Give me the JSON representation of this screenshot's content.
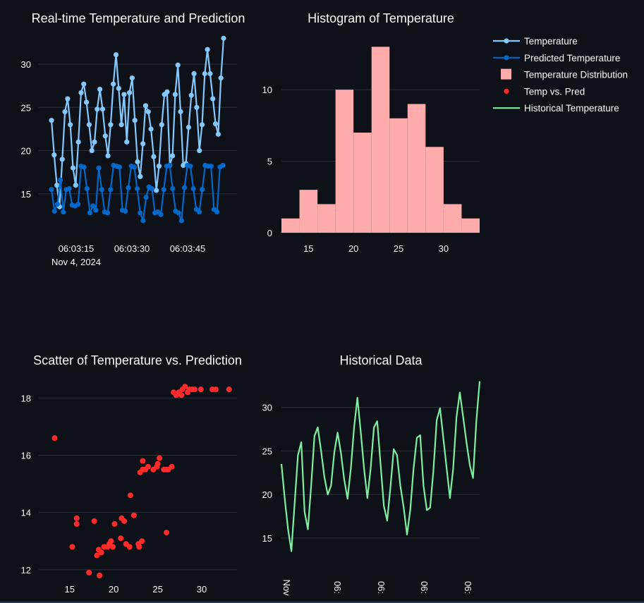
{
  "colors": {
    "background": "#0e1117",
    "grid": "#2c3140",
    "temperature": "#83c9ff",
    "predicted": "#0068c9",
    "histogram": "#ffabab",
    "scatter": "#ff2b2b",
    "historical": "#7defa1"
  },
  "legend": [
    {
      "label": "Temperature",
      "type": "line-marker",
      "color": "#83c9ff"
    },
    {
      "label": "Predicted Temperature",
      "type": "line-marker",
      "color": "#0068c9"
    },
    {
      "label": "Temperature Distribution",
      "type": "square",
      "color": "#ffabab"
    },
    {
      "label": "Temp vs. Pred",
      "type": "dot",
      "color": "#ff2b2b"
    },
    {
      "label": "Historical Temperature",
      "type": "line",
      "color": "#7defa1"
    }
  ],
  "chart_data": [
    {
      "id": "realtime",
      "type": "line",
      "title": "Real-time Temperature and Prediction",
      "x_tick_labels": [
        "06:03:15",
        "06:03:30",
        "06:03:45"
      ],
      "x_date_label": "Nov 4, 2024",
      "ylim": [
        10.5,
        34
      ],
      "y_ticks": [
        15,
        20,
        25,
        30
      ],
      "grid": true,
      "series": [
        {
          "name": "Temperature",
          "color": "#83c9ff",
          "values": [
            23.5,
            19.5,
            16,
            13.5,
            19,
            24.5,
            26,
            23,
            18,
            16,
            21,
            26.7,
            27.7,
            25.6,
            23,
            20,
            21,
            24.8,
            27.1,
            24.8,
            21.7,
            19.4,
            23,
            27.7,
            31.1,
            27.2,
            23,
            26.5,
            21,
            26.7,
            28.4,
            23.5,
            18.7,
            17,
            20.8,
            25.2,
            24.5,
            22.5,
            19.3,
            15.4,
            18.2,
            23,
            26.5,
            26.8,
            18.3,
            19.4,
            26.5,
            29.9,
            24.5,
            18.3,
            18.5,
            22.7,
            26.4,
            28.9,
            25,
            20,
            23,
            28.9,
            31.7,
            28.9,
            26,
            23.1,
            21.9,
            28.4,
            33
          ]
        },
        {
          "name": "Predicted Temperature",
          "color": "#0068c9",
          "values": [
            15.5,
            13,
            13.8,
            16.6,
            12.9,
            15.5,
            15.6,
            13.7,
            13.6,
            13.8,
            18.2,
            18.1,
            15.6,
            12.8,
            13.6,
            13.1,
            18,
            15.5,
            12.9,
            12.8,
            15.5,
            18.3,
            18.2,
            18.1,
            13.1,
            13,
            15.7,
            18.2,
            18.1,
            15.6,
            12.8,
            11.9,
            14.6,
            15.8,
            15.6,
            12.8,
            12.9,
            12.6,
            15.5,
            18.2,
            18.3,
            15.6,
            13,
            12.8,
            11.9,
            15.7,
            18.3,
            18.2,
            15.6,
            13.2,
            12.9,
            15.5,
            18.3,
            18.2,
            18.2,
            13.2,
            12.9,
            18.1,
            18.3
          ]
        }
      ]
    },
    {
      "id": "histogram",
      "type": "bar",
      "title": "Histogram of Temperature",
      "bin_edges": [
        12,
        14,
        16,
        18,
        20,
        22,
        24,
        26,
        28,
        30,
        32,
        34
      ],
      "values": [
        1,
        3,
        2,
        10,
        7,
        13,
        8,
        9,
        6,
        2,
        1
      ],
      "xlim": [
        12,
        34
      ],
      "x_ticks": [
        15,
        20,
        25,
        30
      ],
      "ylim": [
        0,
        14.2
      ],
      "y_ticks": [
        0,
        5,
        10
      ],
      "grid": true
    },
    {
      "id": "scatter",
      "type": "scatter",
      "title": "Scatter of Temperature vs. Prediction",
      "xlim": [
        11.5,
        34
      ],
      "x_ticks": [
        15,
        20,
        25,
        30
      ],
      "ylim": [
        11.7,
        18.6
      ],
      "y_ticks": [
        12,
        14,
        16,
        18
      ],
      "grid": true,
      "points": [
        [
          13.3,
          16.6
        ],
        [
          15.8,
          13.8
        ],
        [
          15.8,
          13.6
        ],
        [
          15.3,
          12.8
        ],
        [
          17.8,
          13.7
        ],
        [
          17.2,
          11.9
        ],
        [
          18.4,
          11.8
        ],
        [
          18.1,
          12.5
        ],
        [
          18.3,
          12.7
        ],
        [
          18.6,
          12.6
        ],
        [
          18.9,
          12.8
        ],
        [
          19.3,
          12.8
        ],
        [
          19.5,
          12.9
        ],
        [
          19.7,
          13.0
        ],
        [
          19.9,
          12.8
        ],
        [
          20.1,
          13.6
        ],
        [
          20.8,
          13.1
        ],
        [
          20.9,
          13.8
        ],
        [
          21.2,
          13.7
        ],
        [
          21.4,
          12.9
        ],
        [
          21.8,
          12.8
        ],
        [
          21.9,
          14.6
        ],
        [
          22.3,
          13.9
        ],
        [
          22.8,
          12.9
        ],
        [
          22.9,
          12.8
        ],
        [
          23.2,
          13.0
        ],
        [
          23.0,
          15.4
        ],
        [
          23.3,
          15.5
        ],
        [
          23.3,
          15.8
        ],
        [
          23.6,
          15.5
        ],
        [
          23.9,
          15.6
        ],
        [
          24.5,
          15.5
        ],
        [
          24.9,
          15.6
        ],
        [
          25.0,
          15.7
        ],
        [
          25.2,
          15.9
        ],
        [
          25.7,
          15.5
        ],
        [
          26.0,
          15.5
        ],
        [
          26.2,
          15.5
        ],
        [
          26.6,
          15.6
        ],
        [
          26.0,
          13.3
        ],
        [
          26.8,
          18.2
        ],
        [
          27.1,
          18.1
        ],
        [
          27.4,
          18.2
        ],
        [
          27.7,
          18.1
        ],
        [
          27.8,
          18.3
        ],
        [
          28.1,
          18.4
        ],
        [
          28.4,
          18.2
        ],
        [
          28.6,
          18.3
        ],
        [
          28.9,
          18.3
        ],
        [
          29.2,
          18.3
        ],
        [
          29.9,
          18.3
        ],
        [
          31.2,
          18.3
        ],
        [
          31.6,
          18.3
        ],
        [
          33.1,
          18.3
        ]
      ]
    },
    {
      "id": "historical",
      "type": "line",
      "title": "Historical Data",
      "x_tick_labels": [
        "Nov",
        "06:",
        "06:",
        "06:",
        "06:",
        "06:"
      ],
      "ylim": [
        12,
        33.2
      ],
      "y_ticks": [
        15,
        20,
        25,
        30
      ],
      "grid": true,
      "series": [
        {
          "name": "Historical Temperature",
          "color": "#7defa1",
          "values": [
            23.5,
            19.5,
            16,
            13.5,
            19,
            24.5,
            26,
            18,
            16,
            21,
            26.7,
            27.7,
            25,
            22,
            20,
            21,
            24.8,
            27.1,
            24.8,
            21.7,
            19.5,
            23,
            27.7,
            31.1,
            27.2,
            23,
            19.6,
            23,
            27.7,
            28.4,
            23.5,
            18.7,
            17,
            20.8,
            25.2,
            24.5,
            21,
            18.5,
            15.4,
            18.2,
            23,
            26.5,
            26.8,
            21,
            18.2,
            18.5,
            22.7,
            28.5,
            29.9,
            26.5,
            23,
            19.6,
            23,
            28.9,
            31.7,
            28.9,
            26,
            23.4,
            21.9,
            28.4,
            33
          ]
        }
      ]
    }
  ]
}
